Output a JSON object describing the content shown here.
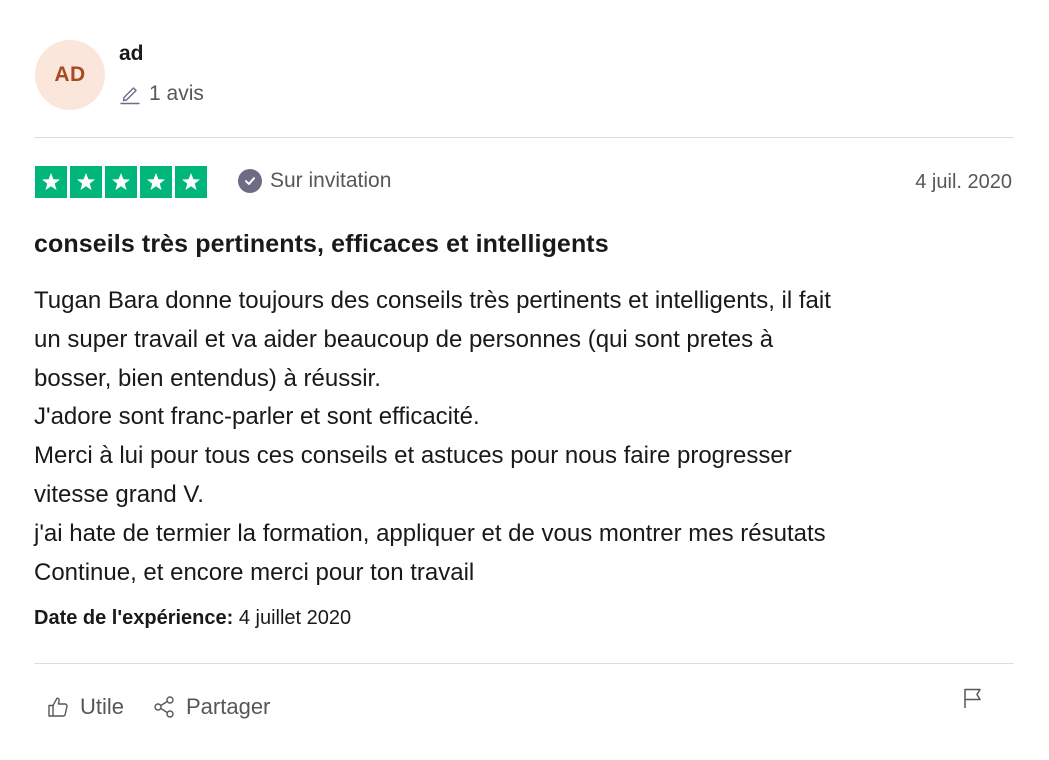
{
  "reviewer": {
    "initials": "AD",
    "name": "ad",
    "review_count": "1 avis",
    "avatar_bg": "#fbe6dc",
    "avatar_fg": "#a74a25"
  },
  "rating": {
    "stars": 5,
    "max_stars": 5,
    "star_color": "#00b67a",
    "verification": "Sur invitation",
    "date": "4 juil. 2020"
  },
  "review": {
    "title": "conseils très pertinents, efficaces et intelligents",
    "lines": [
      "Tugan Bara donne toujours des conseils très pertinents et intelligents, il fait",
      "un super travail et va aider beaucoup de personnes (qui sont pretes à",
      "bosser, bien entendus) à réussir.",
      "J'adore sont franc-parler et sont efficacité.",
      "Merci à lui pour tous ces conseils et astuces pour nous faire progresser",
      "vitesse grand V.",
      "j'ai hate de termier la formation, appliquer et de vous montrer mes résutats",
      "Continue, et encore merci pour ton travail"
    ],
    "experience_label": "Date de l'expérience:",
    "experience_date": "4 juillet 2020"
  },
  "actions": {
    "useful_label": "Utile",
    "share_label": "Partager",
    "useful_icon": "thumbs-up-icon",
    "share_icon": "share-icon",
    "flag_icon": "flag-icon"
  }
}
